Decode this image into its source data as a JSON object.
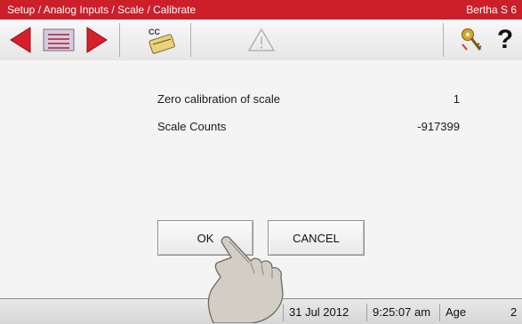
{
  "titlebar": {
    "path": "Setup / Analog Inputs / Scale / Calibrate",
    "device": "Bertha S 6"
  },
  "toolbar": {
    "cc_label": "CC",
    "help_label": "?"
  },
  "main": {
    "rows": [
      {
        "label": "Zero calibration of scale",
        "value": "1"
      },
      {
        "label": "Scale Counts",
        "value": "-917399"
      }
    ],
    "ok_label": "OK",
    "cancel_label": "CANCEL"
  },
  "status": {
    "date": "31 Jul 2012",
    "time": "9:25:07 am",
    "age_label": "Age",
    "age_value": "2"
  },
  "colors": {
    "titlebar": "#cc1f2a",
    "arrow": "#d81e2a",
    "key": "#d8a623"
  }
}
